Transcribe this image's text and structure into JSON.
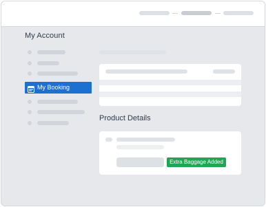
{
  "page": {
    "title": "My Account"
  },
  "sidebar": {
    "active_item": {
      "label": "My Booking",
      "icon": "calendar-icon"
    }
  },
  "product": {
    "section_title": "Product Details",
    "badge": "Extra Baggage Added"
  },
  "colors": {
    "accent": "#1d6fd0",
    "success": "#21a453",
    "background": "#e6e8ec"
  }
}
